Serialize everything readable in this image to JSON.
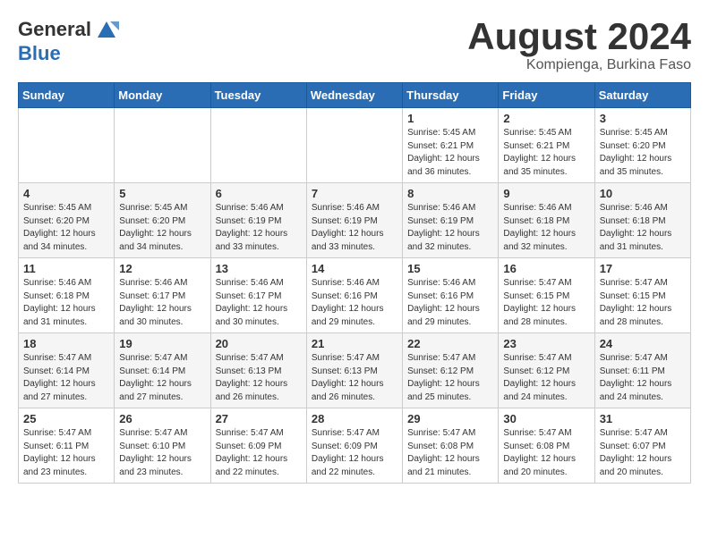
{
  "header": {
    "logo_general": "General",
    "logo_blue": "Blue",
    "month_title": "August 2024",
    "location": "Kompienga, Burkina Faso"
  },
  "weekdays": [
    "Sunday",
    "Monday",
    "Tuesday",
    "Wednesday",
    "Thursday",
    "Friday",
    "Saturday"
  ],
  "weeks": [
    [
      {
        "day": "",
        "info": ""
      },
      {
        "day": "",
        "info": ""
      },
      {
        "day": "",
        "info": ""
      },
      {
        "day": "",
        "info": ""
      },
      {
        "day": "1",
        "info": "Sunrise: 5:45 AM\nSunset: 6:21 PM\nDaylight: 12 hours\nand 36 minutes."
      },
      {
        "day": "2",
        "info": "Sunrise: 5:45 AM\nSunset: 6:21 PM\nDaylight: 12 hours\nand 35 minutes."
      },
      {
        "day": "3",
        "info": "Sunrise: 5:45 AM\nSunset: 6:20 PM\nDaylight: 12 hours\nand 35 minutes."
      }
    ],
    [
      {
        "day": "4",
        "info": "Sunrise: 5:45 AM\nSunset: 6:20 PM\nDaylight: 12 hours\nand 34 minutes."
      },
      {
        "day": "5",
        "info": "Sunrise: 5:45 AM\nSunset: 6:20 PM\nDaylight: 12 hours\nand 34 minutes."
      },
      {
        "day": "6",
        "info": "Sunrise: 5:46 AM\nSunset: 6:19 PM\nDaylight: 12 hours\nand 33 minutes."
      },
      {
        "day": "7",
        "info": "Sunrise: 5:46 AM\nSunset: 6:19 PM\nDaylight: 12 hours\nand 33 minutes."
      },
      {
        "day": "8",
        "info": "Sunrise: 5:46 AM\nSunset: 6:19 PM\nDaylight: 12 hours\nand 32 minutes."
      },
      {
        "day": "9",
        "info": "Sunrise: 5:46 AM\nSunset: 6:18 PM\nDaylight: 12 hours\nand 32 minutes."
      },
      {
        "day": "10",
        "info": "Sunrise: 5:46 AM\nSunset: 6:18 PM\nDaylight: 12 hours\nand 31 minutes."
      }
    ],
    [
      {
        "day": "11",
        "info": "Sunrise: 5:46 AM\nSunset: 6:18 PM\nDaylight: 12 hours\nand 31 minutes."
      },
      {
        "day": "12",
        "info": "Sunrise: 5:46 AM\nSunset: 6:17 PM\nDaylight: 12 hours\nand 30 minutes."
      },
      {
        "day": "13",
        "info": "Sunrise: 5:46 AM\nSunset: 6:17 PM\nDaylight: 12 hours\nand 30 minutes."
      },
      {
        "day": "14",
        "info": "Sunrise: 5:46 AM\nSunset: 6:16 PM\nDaylight: 12 hours\nand 29 minutes."
      },
      {
        "day": "15",
        "info": "Sunrise: 5:46 AM\nSunset: 6:16 PM\nDaylight: 12 hours\nand 29 minutes."
      },
      {
        "day": "16",
        "info": "Sunrise: 5:47 AM\nSunset: 6:15 PM\nDaylight: 12 hours\nand 28 minutes."
      },
      {
        "day": "17",
        "info": "Sunrise: 5:47 AM\nSunset: 6:15 PM\nDaylight: 12 hours\nand 28 minutes."
      }
    ],
    [
      {
        "day": "18",
        "info": "Sunrise: 5:47 AM\nSunset: 6:14 PM\nDaylight: 12 hours\nand 27 minutes."
      },
      {
        "day": "19",
        "info": "Sunrise: 5:47 AM\nSunset: 6:14 PM\nDaylight: 12 hours\nand 27 minutes."
      },
      {
        "day": "20",
        "info": "Sunrise: 5:47 AM\nSunset: 6:13 PM\nDaylight: 12 hours\nand 26 minutes."
      },
      {
        "day": "21",
        "info": "Sunrise: 5:47 AM\nSunset: 6:13 PM\nDaylight: 12 hours\nand 26 minutes."
      },
      {
        "day": "22",
        "info": "Sunrise: 5:47 AM\nSunset: 6:12 PM\nDaylight: 12 hours\nand 25 minutes."
      },
      {
        "day": "23",
        "info": "Sunrise: 5:47 AM\nSunset: 6:12 PM\nDaylight: 12 hours\nand 24 minutes."
      },
      {
        "day": "24",
        "info": "Sunrise: 5:47 AM\nSunset: 6:11 PM\nDaylight: 12 hours\nand 24 minutes."
      }
    ],
    [
      {
        "day": "25",
        "info": "Sunrise: 5:47 AM\nSunset: 6:11 PM\nDaylight: 12 hours\nand 23 minutes."
      },
      {
        "day": "26",
        "info": "Sunrise: 5:47 AM\nSunset: 6:10 PM\nDaylight: 12 hours\nand 23 minutes."
      },
      {
        "day": "27",
        "info": "Sunrise: 5:47 AM\nSunset: 6:09 PM\nDaylight: 12 hours\nand 22 minutes."
      },
      {
        "day": "28",
        "info": "Sunrise: 5:47 AM\nSunset: 6:09 PM\nDaylight: 12 hours\nand 22 minutes."
      },
      {
        "day": "29",
        "info": "Sunrise: 5:47 AM\nSunset: 6:08 PM\nDaylight: 12 hours\nand 21 minutes."
      },
      {
        "day": "30",
        "info": "Sunrise: 5:47 AM\nSunset: 6:08 PM\nDaylight: 12 hours\nand 20 minutes."
      },
      {
        "day": "31",
        "info": "Sunrise: 5:47 AM\nSunset: 6:07 PM\nDaylight: 12 hours\nand 20 minutes."
      }
    ]
  ]
}
